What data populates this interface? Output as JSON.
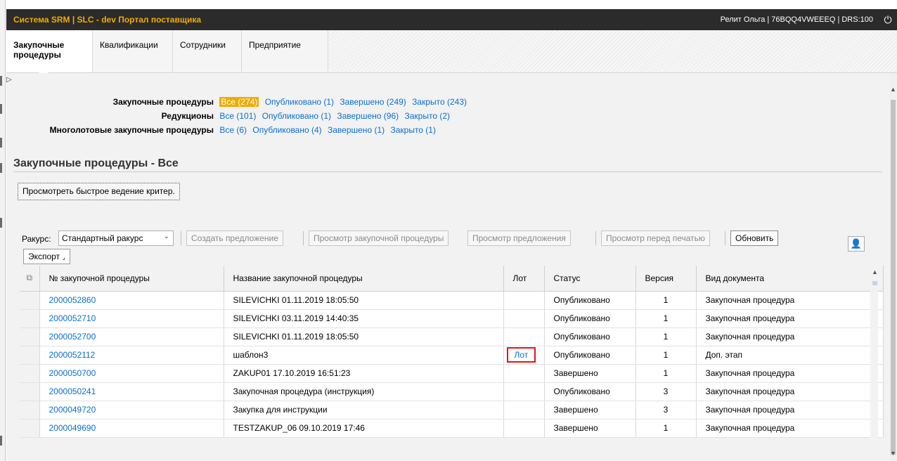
{
  "app": {
    "title": "Система SRM | SLC - dev Портал поставщика",
    "user_info": "Релит Ольга | 76BQQ4VWEEEQ | DRS:100",
    "power_icon": "power-icon"
  },
  "nav": {
    "tabs": [
      {
        "label_line1": "Закупочные",
        "label_line2": "процедуры",
        "active": true
      },
      {
        "label_line1": "Квалификации",
        "label_line2": "",
        "active": false
      },
      {
        "label_line1": "Сотрудники",
        "label_line2": "",
        "active": false
      },
      {
        "label_line1": "Предприятие",
        "label_line2": "",
        "active": false
      }
    ]
  },
  "filters": {
    "rows": [
      {
        "label": "Закупочные процедуры",
        "links": [
          "Все (274)",
          "Опубликовано (1)",
          "Завершено (249)",
          "Закрыто (243)"
        ],
        "selected": 0
      },
      {
        "label": "Редукционы",
        "links": [
          "Все (101)",
          "Опубликовано (1)",
          "Завершено (96)",
          "Закрыто (2)"
        ],
        "selected": -1
      },
      {
        "label": "Многолотовые закупочные процедуры",
        "links": [
          "Все (6)",
          "Опубликовано (4)",
          "Завершено (1)",
          "Закрыто (1)"
        ],
        "selected": -1
      }
    ]
  },
  "page": {
    "heading": "Закупочные процедуры - Все",
    "quick_view_button": "Просмотреть быстрое ведение критер."
  },
  "toolbar": {
    "view_label": "Ракурс:",
    "view_value": "Стандартный ракурс",
    "create_offer": "Создать предложение",
    "view_procedure": "Просмотр закупочной процедуры",
    "view_offer": "Просмотр предложения",
    "print_preview": "Просмотр перед печатью",
    "refresh": "Обновить",
    "export": "Экспорт",
    "export_icon": "dropdown-corner-icon",
    "settings_icon": "user-settings-icon"
  },
  "table": {
    "headers": [
      "№ закупочной процедуры",
      "Название закупочной процедуры",
      "Лот",
      "Статус",
      "Версия",
      "Вид документа"
    ],
    "rows": [
      {
        "num": "2000052860",
        "name": "SILEVICHKI 01.11.2019 18:05:50",
        "lot": "",
        "status": "Опубликовано",
        "version": "1",
        "doctype": "Закупочная процедура"
      },
      {
        "num": "2000052710",
        "name": "SILEVICHKI 03.11.2019 14:40:35",
        "lot": "",
        "status": "Опубликовано",
        "version": "1",
        "doctype": "Закупочная процедура"
      },
      {
        "num": "2000052700",
        "name": "SILEVICHKI 01.11.2019 18:05:50",
        "lot": "",
        "status": "Опубликовано",
        "version": "1",
        "doctype": "Закупочная процедура"
      },
      {
        "num": "2000052112",
        "name": "шаблон3",
        "lot": "Лот",
        "status": "Опубликовано",
        "version": "1",
        "doctype": "Доп. этап"
      },
      {
        "num": "2000050700",
        "name": "ZAKUP01 17.10.2019 16:51:23",
        "lot": "",
        "status": "Завершено",
        "version": "1",
        "doctype": "Закупочная процедура"
      },
      {
        "num": "2000050241",
        "name": "Закупочная процедура (инструкция)",
        "lot": "",
        "status": "Опубликовано",
        "version": "3",
        "doctype": "Закупочная процедура"
      },
      {
        "num": "2000049720",
        "name": "Закупка для инструкции",
        "lot": "",
        "status": "Завершено",
        "version": "3",
        "doctype": "Закупочная процедура"
      },
      {
        "num": "2000049690",
        "name": "TESTZAKUP_06 09.10.2019 17:46",
        "lot": "",
        "status": "Завершено",
        "version": "1",
        "doctype": "Закупочная процедура"
      }
    ]
  },
  "colors": {
    "header_bg": "#2b2b2b",
    "title_accent": "#f0ab00",
    "link": "#0a6ed1",
    "highlight_border": "#e3141a"
  }
}
